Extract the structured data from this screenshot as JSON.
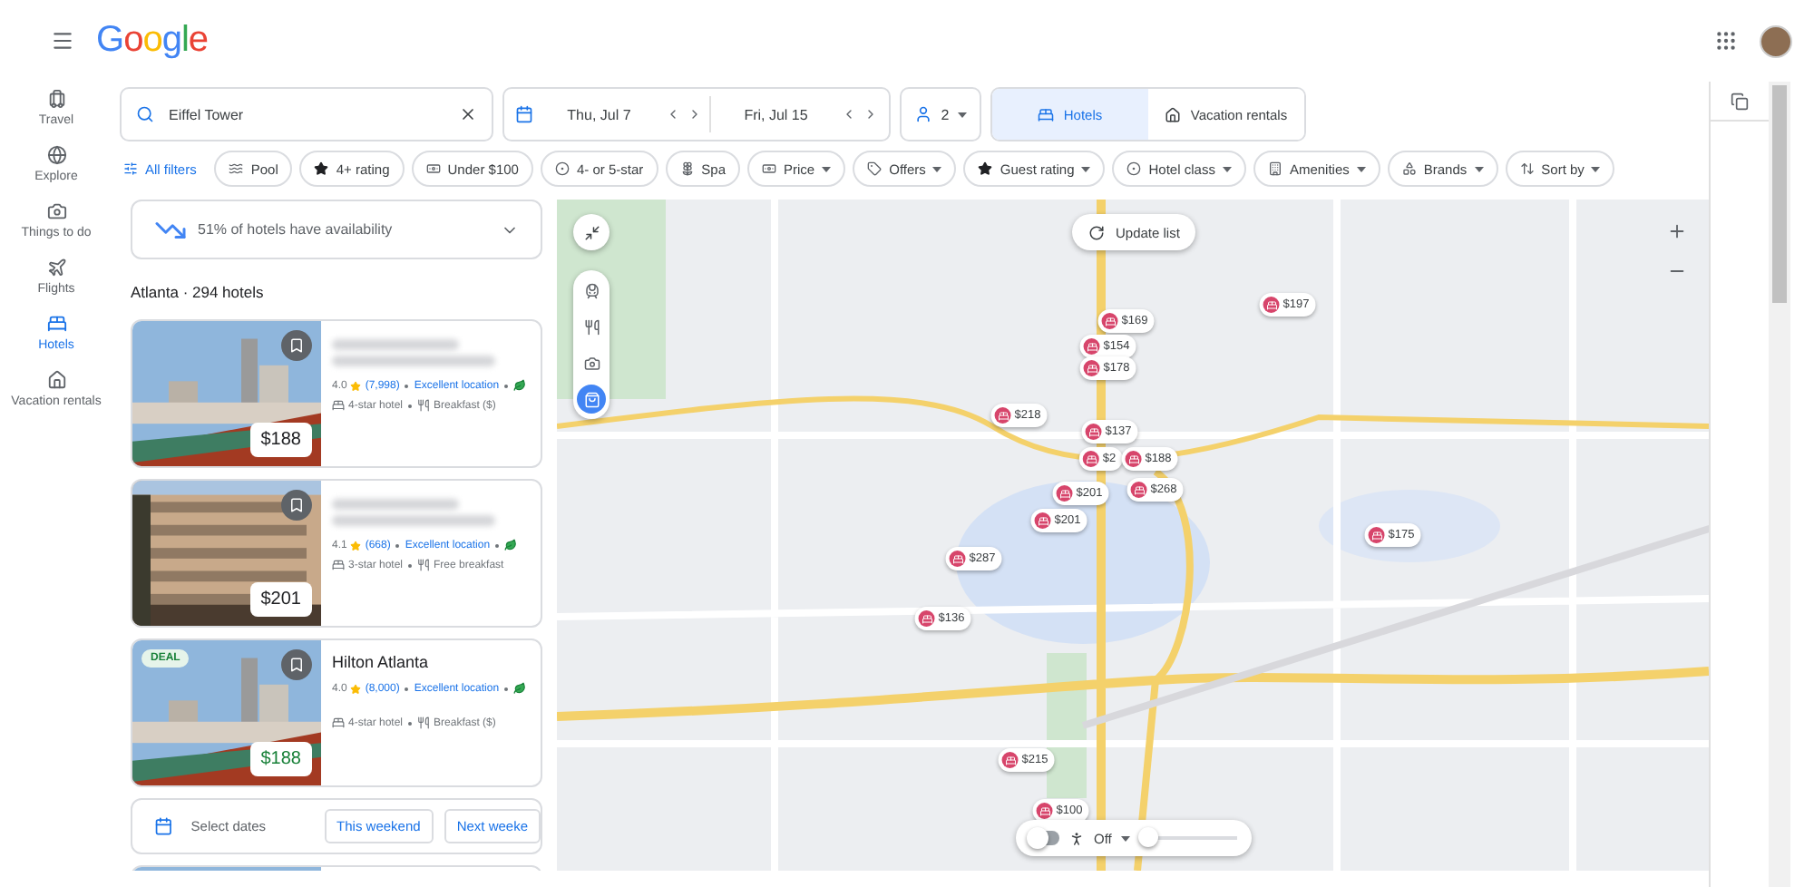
{
  "header": {
    "logo": "Google"
  },
  "rail": [
    {
      "kind": "travel",
      "label": "Travel",
      "selected": false
    },
    {
      "kind": "explore",
      "label": "Explore",
      "selected": false
    },
    {
      "kind": "activities",
      "label": "Things to do",
      "selected": false
    },
    {
      "kind": "flights",
      "label": "Flights",
      "selected": false
    },
    {
      "kind": "hotels",
      "label": "Hotels",
      "selected": true
    },
    {
      "kind": "rentals",
      "label": "Vacation rentals",
      "selected": false
    }
  ],
  "search": {
    "value": "Eiffel Tower"
  },
  "dates": {
    "check_in": "Thu, Jul 7",
    "check_out": "Fri, Jul 15"
  },
  "guests": "2",
  "tabs": [
    {
      "kind": "hotels",
      "label": "Hotels",
      "selected": true
    },
    {
      "kind": "rentals",
      "label": "Vacation rentals",
      "selected": false
    }
  ],
  "filters": {
    "all": "All filters",
    "chips": [
      {
        "kind": "pool",
        "label": "Pool",
        "dropdown": false
      },
      {
        "kind": "star",
        "label": "4+ rating",
        "dropdown": false
      },
      {
        "kind": "money",
        "label": "Under $100",
        "dropdown": false
      },
      {
        "kind": "target",
        "label": "4- or 5-star",
        "dropdown": false
      },
      {
        "kind": "spa",
        "label": "Spa",
        "dropdown": false
      },
      {
        "kind": "money",
        "label": "Price",
        "dropdown": true
      },
      {
        "kind": "tag",
        "label": "Offers",
        "dropdown": true
      },
      {
        "kind": "star",
        "label": "Guest rating",
        "dropdown": true
      },
      {
        "kind": "target",
        "label": "Hotel class",
        "dropdown": true
      },
      {
        "kind": "building",
        "label": "Amenities",
        "dropdown": true
      },
      {
        "kind": "shapes",
        "label": "Brands",
        "dropdown": true
      },
      {
        "kind": "sort",
        "label": "Sort by",
        "dropdown": true
      }
    ]
  },
  "availability": "51% of hotels have availability",
  "results_title": "Atlanta · 294 hotels",
  "hotels": [
    {
      "kind": "rooftop",
      "price": "$188",
      "rating": "4.0",
      "reviews": "(7,998)",
      "location": "Excellent location",
      "eco": true,
      "hotel_class": "4-star hotel",
      "breakfast": "Breakfast ($)"
    },
    {
      "kind": "facade",
      "price": "$201",
      "rating": "4.1",
      "reviews": "(668)",
      "location": "Excellent location",
      "eco": true,
      "hotel_class": "3-star hotel",
      "breakfast": "Free breakfast"
    },
    {
      "kind": "rooftop",
      "badge": "DEAL",
      "name": "Hilton Atlanta",
      "price": "$188",
      "rating": "4.0",
      "reviews": "(8,000)",
      "location": "Excellent location",
      "eco": true,
      "hotel_class": "4-star hotel",
      "breakfast": "Breakfast ($)"
    }
  ],
  "date_prompt": {
    "label": "Select dates",
    "options": [
      "This weekend",
      "Next weeke"
    ]
  },
  "map": {
    "update": "Update list",
    "layers": [
      {
        "kind": "transit",
        "selected": false
      },
      {
        "kind": "restaurant",
        "selected": false
      },
      {
        "kind": "attraction",
        "selected": false
      },
      {
        "kind": "shopping",
        "selected": true
      }
    ],
    "pins": [
      {
        "price": "$197"
      },
      {
        "price": "$169"
      },
      {
        "price": "$154"
      },
      {
        "price": "$178"
      },
      {
        "price": "$218"
      },
      {
        "price": "$137"
      },
      {
        "price": "$2"
      },
      {
        "price": "$188"
      },
      {
        "price": "$268"
      },
      {
        "price": "$201"
      },
      {
        "price": "$201"
      },
      {
        "price": "$287"
      },
      {
        "price": "$136"
      },
      {
        "price": "$175"
      },
      {
        "price": "$215"
      },
      {
        "price": "$100"
      }
    ],
    "walk": {
      "on": false,
      "label": "Off",
      "level": 0
    }
  }
}
